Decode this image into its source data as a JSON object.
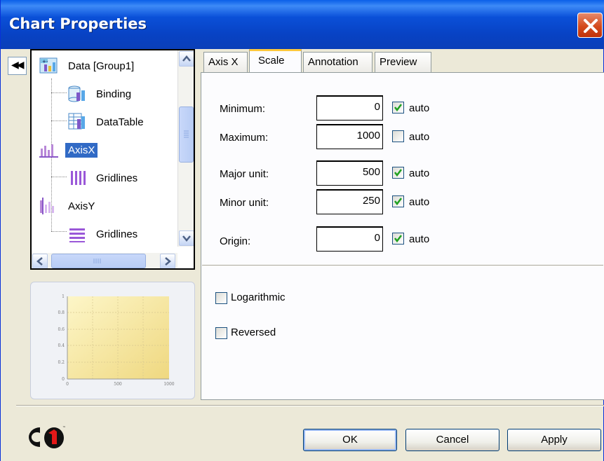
{
  "window": {
    "title": "Chart Properties"
  },
  "tree": {
    "items": [
      {
        "label": "Data [Group1]",
        "icon": "data-group-icon"
      },
      {
        "label": "Binding",
        "icon": "binding-icon"
      },
      {
        "label": "DataTable",
        "icon": "datatable-icon"
      },
      {
        "label": "AxisX",
        "icon": "axis-x-icon",
        "selected": true
      },
      {
        "label": "Gridlines",
        "icon": "vertical-gridlines-icon"
      },
      {
        "label": "AxisY",
        "icon": "axis-y-icon"
      },
      {
        "label": "Gridlines",
        "icon": "horizontal-gridlines-icon"
      }
    ]
  },
  "mini_chart": {
    "y_ticks": [
      "1",
      "0.8",
      "0.6",
      "0.4",
      "0.2",
      "0"
    ],
    "x_ticks": [
      "0",
      "500",
      "1000"
    ]
  },
  "tabs": [
    {
      "label": "Axis X"
    },
    {
      "label": "Scale",
      "active": true
    },
    {
      "label": "Annotation"
    },
    {
      "label": "Preview"
    }
  ],
  "scale": {
    "minimum": {
      "label": "Minimum:",
      "value": "0",
      "auto": true
    },
    "maximum": {
      "label": "Maximum:",
      "value": "1000",
      "auto": false
    },
    "major_unit": {
      "label": "Major unit:",
      "value": "500",
      "auto": true
    },
    "minor_unit": {
      "label": "Minor unit:",
      "value": "250",
      "auto": true
    },
    "origin": {
      "label": "Origin:",
      "value": "0",
      "auto": true
    },
    "auto_label": "auto",
    "logarithmic": {
      "label": "Logarithmic",
      "checked": false
    },
    "reversed": {
      "label": "Reversed",
      "checked": false
    }
  },
  "buttons": {
    "ok": "OK",
    "cancel": "Cancel",
    "apply": "Apply"
  },
  "colors": {
    "title_bar": "#0a50d8",
    "selection": "#316ac5",
    "active_tab_accent": "#ffc83c",
    "check": "#21a121"
  }
}
